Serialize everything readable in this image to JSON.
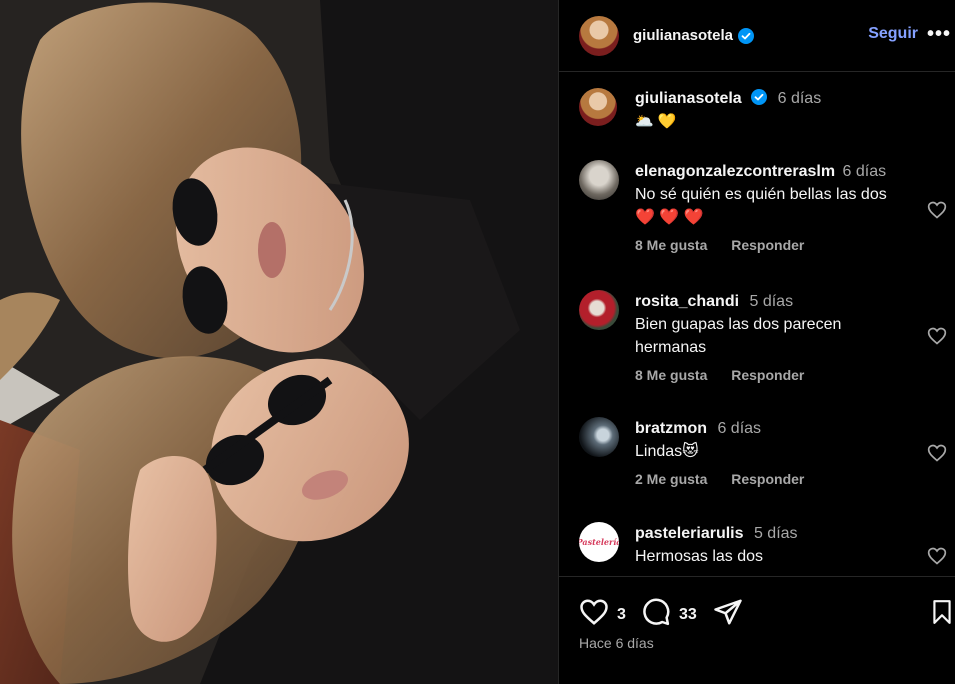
{
  "post": {
    "username": "giulianasotela",
    "follow_label": "Seguir",
    "more_label": "•••",
    "caption_time": "6 días",
    "caption_text": "🌥️ 💛",
    "posted_ago": "Hace 6 días"
  },
  "comments": [
    {
      "username": "elenagonzalezcontreraslm",
      "time": "6 días",
      "text": "No sé quién es quién bellas las dos",
      "emoji": "❤️ ❤️ ❤️",
      "likes": "8 Me gusta",
      "reply": "Responder"
    },
    {
      "username": "rosita_chandi",
      "time": "5 días",
      "text": "Bien guapas las dos parecen hermanas",
      "likes": "8 Me gusta",
      "reply": "Responder"
    },
    {
      "username": "bratzmon",
      "time": "6 días",
      "text": "Lindas😻",
      "likes": "2 Me gusta",
      "reply": "Responder"
    },
    {
      "username": "pasteleriarulis",
      "time": "5 días",
      "text": "Hermosas las dos",
      "avatar_text": "Pastelería"
    }
  ],
  "actions": {
    "like_count": "3",
    "comment_count": "33"
  },
  "colors": {
    "accent": "#85a1ff",
    "verified": "#0095f6",
    "muted": "#a8a8a8",
    "border": "#262626"
  },
  "icons": [
    "verified-badge-icon",
    "heart-icon",
    "comment-icon",
    "share-icon",
    "bookmark-icon",
    "more-icon"
  ]
}
